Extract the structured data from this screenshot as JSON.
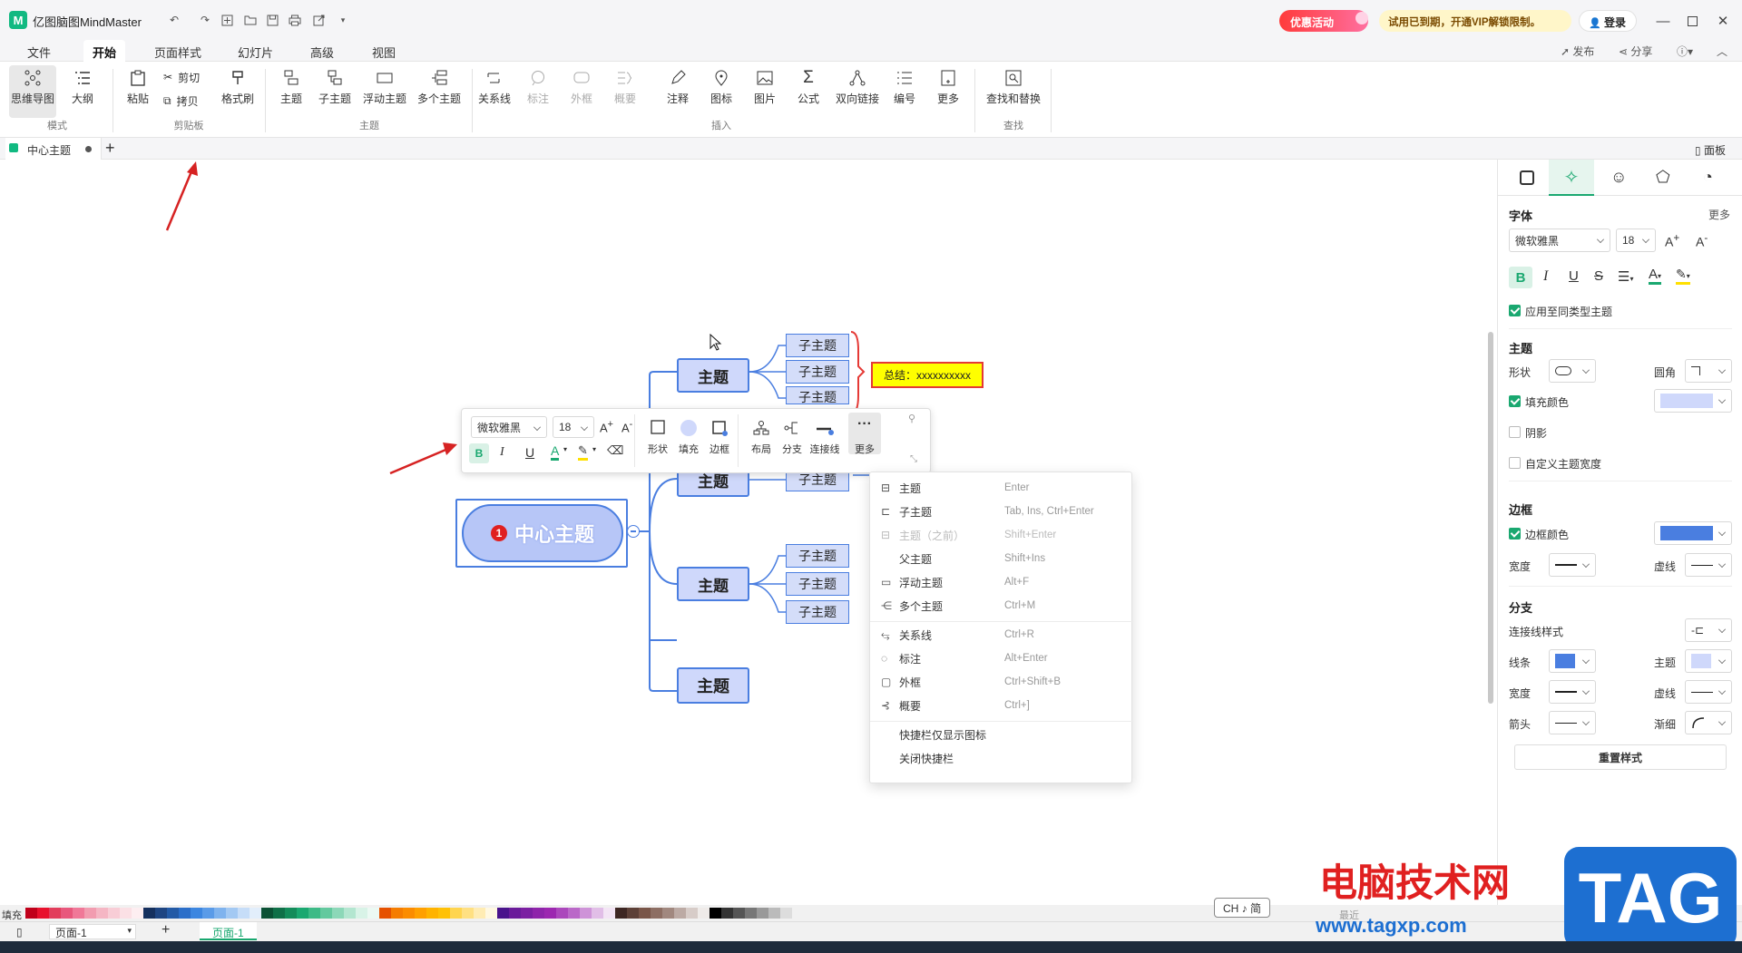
{
  "app": {
    "title": "亿图脑图MindMaster"
  },
  "titlebar": {
    "promo": "优惠活动",
    "trial": "试用已到期，开通VIP解锁限制。",
    "login": "登录",
    "publish": "发布",
    "share": "分享"
  },
  "menu": [
    "文件",
    "开始",
    "页面样式",
    "幻灯片",
    "高级",
    "视图"
  ],
  "ribbon": {
    "mode": [
      "思维导图",
      "大纲"
    ],
    "clipboard": [
      "粘贴",
      "剪切",
      "拷贝",
      "格式刷"
    ],
    "topic": [
      "主题",
      "子主题",
      "浮动主题",
      "多个主题"
    ],
    "insert": [
      "关系线",
      "标注",
      "外框",
      "概要",
      "注释",
      "图标",
      "图片",
      "公式",
      "双向链接",
      "编号",
      "更多"
    ],
    "find": [
      "查找和替换"
    ],
    "groups": [
      "模式",
      "剪贴板",
      "主题",
      "插入",
      "查找"
    ]
  },
  "doc_tab": {
    "title": "中心主题"
  },
  "panel_toggle": "面板",
  "mindmap": {
    "central": "中心主题",
    "central_badge": "1",
    "topics": [
      "主题",
      "主题",
      "主题",
      "主题"
    ],
    "subtopics": [
      "子主题",
      "子主题",
      "子主题",
      "子主题",
      "子主题",
      "子主题",
      "子主题"
    ],
    "summary": "总结：xxxxxxxxxx"
  },
  "floatbar": {
    "font": "微软雅黑",
    "size": "18",
    "labels": [
      "形状",
      "填充",
      "边框",
      "布局",
      "分支",
      "连接线",
      "更多"
    ]
  },
  "context_menu": [
    {
      "label": "主题",
      "key": "Enter",
      "disabled": false
    },
    {
      "label": "子主题",
      "key": "Tab, Ins, Ctrl+Enter",
      "disabled": false
    },
    {
      "label": "主题（之前）",
      "key": "Shift+Enter",
      "disabled": true
    },
    {
      "label": "父主题",
      "key": "Shift+Ins",
      "disabled": false
    },
    {
      "label": "浮动主题",
      "key": "Alt+F",
      "disabled": false
    },
    {
      "label": "多个主题",
      "key": "Ctrl+M",
      "disabled": false
    },
    {
      "label": "关系线",
      "key": "Ctrl+R",
      "disabled": false
    },
    {
      "label": "标注",
      "key": "Alt+Enter",
      "disabled": false
    },
    {
      "label": "外框",
      "key": "Ctrl+Shift+B",
      "disabled": false
    },
    {
      "label": "概要",
      "key": "Ctrl+]",
      "disabled": false
    },
    {
      "label": "快捷栏仅显示图标",
      "key": "",
      "disabled": false
    },
    {
      "label": "关闭快捷栏",
      "key": "",
      "disabled": false
    }
  ],
  "panel": {
    "font_title": "字体",
    "more": "更多",
    "font": "微软雅黑",
    "size": "18",
    "apply_same": "应用至同类型主题",
    "topic_title": "主题",
    "shape": "形状",
    "corner": "圆角",
    "fill_color": "填充颜色",
    "shadow": "阴影",
    "custom_width": "自定义主题宽度",
    "border_title": "边框",
    "border_color": "边框颜色",
    "width": "宽度",
    "dash": "虚线",
    "branch_title": "分支",
    "connector_style": "连接线样式",
    "line": "线条",
    "topic": "主题",
    "width2": "宽度",
    "dash2": "虚线",
    "arrow": "箭头",
    "taper": "渐细",
    "reset": "重置样式"
  },
  "bottom": {
    "fill_label": "填充",
    "recent": "最近",
    "page": "页面-1",
    "page_tab": "页面-1",
    "ime": "CH ♪ 简"
  },
  "watermark": {
    "title": "电脑技术网",
    "url": "www.tagxp.com",
    "tag": "TAG"
  },
  "colors": {
    "accent": "#1aa870",
    "topic_fill": "#cfd8fb",
    "topic_border": "#4a7ee0",
    "summary_fill": "#ffff00",
    "summary_border": "#e53935",
    "annot_arrow": "#d62222"
  }
}
